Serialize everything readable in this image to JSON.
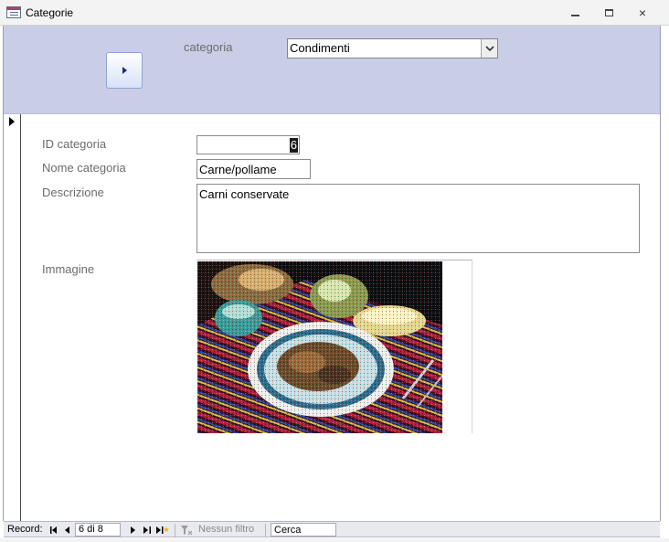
{
  "window": {
    "title": "Categorie",
    "controls": {
      "minimize": "minimize-icon",
      "restore": "restore-icon",
      "close": "×"
    }
  },
  "header": {
    "category_label": "categoria",
    "category_combo_value": "Condimenti",
    "nav_button_icon": "play-icon"
  },
  "detail": {
    "id_label": "ID categoria",
    "id_value": "6",
    "name_label": "Nome categoria",
    "name_value": "Carne/pollame",
    "description_label": "Descrizione",
    "description_value": "Carni conservate",
    "image_label": "Immagine"
  },
  "navigation": {
    "record_label": "Record:",
    "record_position": "6 di 8",
    "filter_label": "Nessun filtro",
    "search_value": "Cerca"
  },
  "colors": {
    "header_background": "#c9cde6",
    "label_text": "#6c6c6c",
    "nav_bar": "#e9eaf0"
  }
}
